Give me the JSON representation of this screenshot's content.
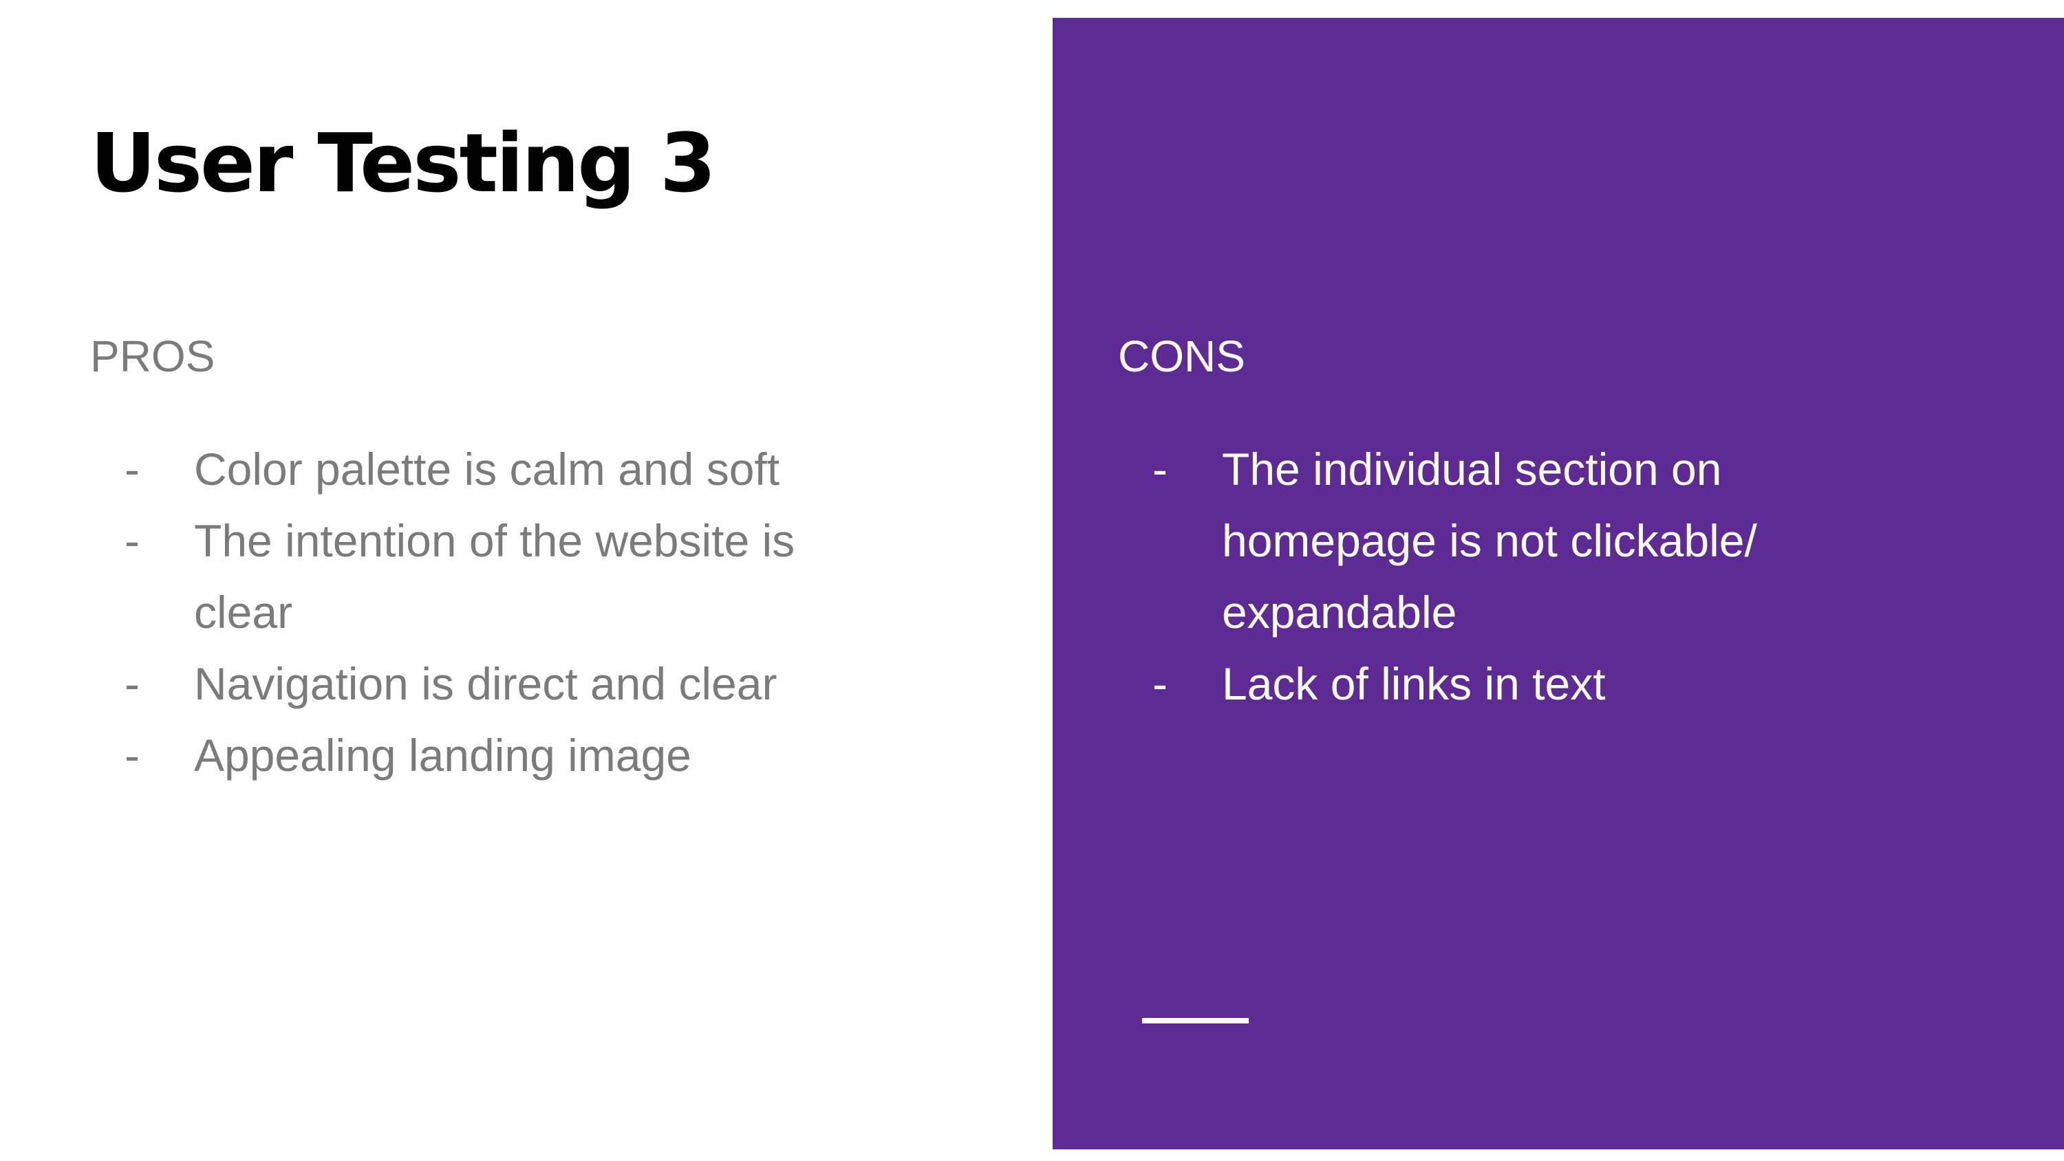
{
  "slide": {
    "title": "User Testing 3",
    "pros": {
      "heading": "PROS",
      "items": [
        "Color palette is calm and soft",
        "The intention of the website is",
        "clear",
        "Navigation is direct and clear",
        "Appealing landing image"
      ]
    },
    "cons": {
      "heading": "CONS",
      "items": [
        "The individual section on",
        "homepage is not clickable/",
        "expandable",
        "Lack of links in text"
      ]
    },
    "dash": "-"
  },
  "colors": {
    "panel": "#5e2b94",
    "pros_text": "#7b7b7b",
    "title_text": "#000000",
    "cons_text": "#ffffff"
  }
}
